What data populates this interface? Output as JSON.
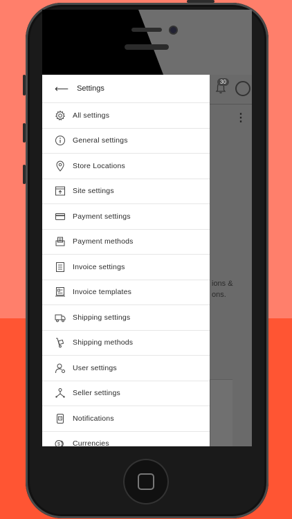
{
  "background_app": {
    "notification_count": "30",
    "text_line1": "ions &",
    "text_line2": "ons."
  },
  "drawer": {
    "title": "Settings",
    "items": [
      {
        "label": "All settings",
        "icon": "gear-icon"
      },
      {
        "label": "General settings",
        "icon": "info-icon"
      },
      {
        "label": "Store Locations",
        "icon": "location-pin-icon"
      },
      {
        "label": "Site settings",
        "icon": "site-browser-icon"
      },
      {
        "label": "Payment settings",
        "icon": "credit-card-icon"
      },
      {
        "label": "Payment methods",
        "icon": "payment-terminal-icon"
      },
      {
        "label": "Invoice settings",
        "icon": "invoice-list-icon"
      },
      {
        "label": "Invoice templates",
        "icon": "invoice-template-icon"
      },
      {
        "label": "Shipping settings",
        "icon": "truck-icon"
      },
      {
        "label": "Shipping methods",
        "icon": "hand-truck-icon"
      },
      {
        "label": "User settings",
        "icon": "user-gear-icon"
      },
      {
        "label": "Seller settings",
        "icon": "seller-network-icon"
      },
      {
        "label": "Notifications",
        "icon": "notification-phone-icon"
      },
      {
        "label": "Currencies",
        "icon": "coins-icon"
      }
    ]
  }
}
